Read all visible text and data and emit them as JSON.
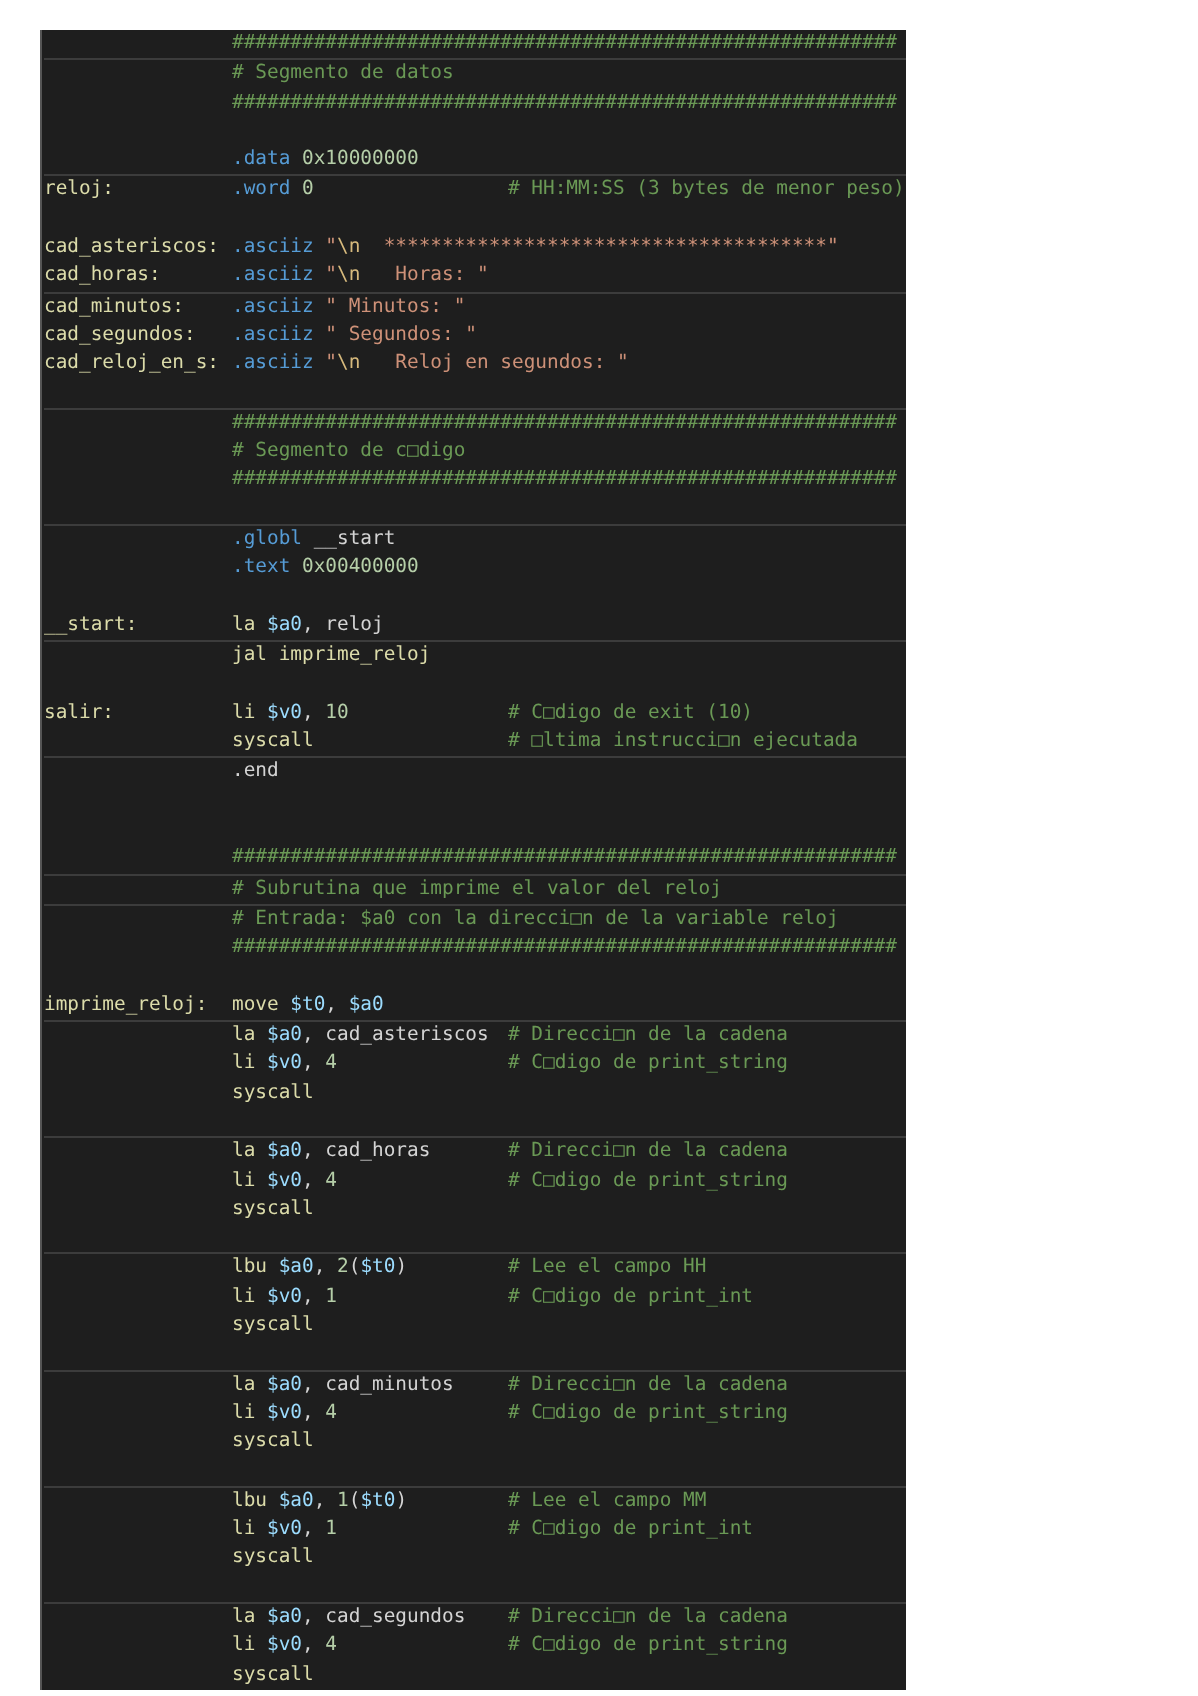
{
  "code_rows": [
    {
      "lines": [
        {
          "kind": "code",
          "tokens": [
            {
              "text": "#########################################################",
              "kind": "com"
            }
          ]
        }
      ]
    },
    {
      "lines": [
        {
          "kind": "code",
          "tokens": [
            {
              "text": "# Segmento de datos",
              "kind": "com"
            }
          ]
        },
        {
          "kind": "code",
          "tokens": [
            {
              "text": "#########################################################",
              "kind": "com"
            }
          ]
        },
        {
          "kind": "blank"
        },
        {
          "kind": "code",
          "tokens": [
            {
              "text": ".data",
              "kind": "dir"
            },
            {
              "text": " 0x10000000",
              "kind": "num"
            }
          ]
        }
      ]
    },
    {
      "lines": [
        {
          "kind": "code",
          "label": "reloj:",
          "tokens": [
            {
              "text": ".word",
              "kind": "dir"
            },
            {
              "text": " 0",
              "kind": "num"
            }
          ],
          "comment": "# HH:MM:SS (3 bytes de menor peso)"
        },
        {
          "kind": "blank"
        },
        {
          "kind": "code",
          "label": "cad_asteriscos:",
          "tokens": [
            {
              "text": ".asciiz",
              "kind": "dir"
            },
            {
              "text": " \"",
              "kind": "str"
            },
            {
              "text": "\\n",
              "kind": "esc"
            },
            {
              "text": "  **************************************\"",
              "kind": "str"
            }
          ]
        },
        {
          "kind": "code",
          "label": "cad_horas:",
          "tokens": [
            {
              "text": ".asciiz",
              "kind": "dir"
            },
            {
              "text": " \"",
              "kind": "str"
            },
            {
              "text": "\\n",
              "kind": "esc"
            },
            {
              "text": "   Horas: \"",
              "kind": "str"
            }
          ]
        }
      ]
    },
    {
      "lines": [
        {
          "kind": "code",
          "label": "cad_minutos:",
          "tokens": [
            {
              "text": ".asciiz",
              "kind": "dir"
            },
            {
              "text": " \" Minutos: \"",
              "kind": "str"
            }
          ]
        },
        {
          "kind": "code",
          "label": "cad_segundos:",
          "tokens": [
            {
              "text": ".asciiz",
              "kind": "dir"
            },
            {
              "text": " \" Segundos: \"",
              "kind": "str"
            }
          ]
        },
        {
          "kind": "code",
          "label": "cad_reloj_en_s:",
          "tokens": [
            {
              "text": ".asciiz",
              "kind": "dir"
            },
            {
              "text": " \"",
              "kind": "str"
            },
            {
              "text": "\\n",
              "kind": "esc"
            },
            {
              "text": "   Reloj en segundos: \"",
              "kind": "str"
            }
          ]
        },
        {
          "kind": "blank"
        }
      ]
    },
    {
      "lines": [
        {
          "kind": "code",
          "tokens": [
            {
              "text": "#########################################################",
              "kind": "com"
            }
          ]
        },
        {
          "kind": "code",
          "tokens": [
            {
              "text": "# Segmento de c□digo",
              "kind": "com"
            }
          ]
        },
        {
          "kind": "code",
          "tokens": [
            {
              "text": "#########################################################",
              "kind": "com"
            }
          ]
        },
        {
          "kind": "blank"
        }
      ]
    },
    {
      "lines": [
        {
          "kind": "code",
          "tokens": [
            {
              "text": ".globl",
              "kind": "dir"
            },
            {
              "text": " __start",
              "kind": "txt"
            }
          ]
        },
        {
          "kind": "code",
          "tokens": [
            {
              "text": ".text",
              "kind": "dir"
            },
            {
              "text": " 0x00400000",
              "kind": "num"
            }
          ]
        },
        {
          "kind": "blank"
        },
        {
          "kind": "code",
          "label": "__start:",
          "tokens": [
            {
              "text": "la ",
              "kind": "op"
            },
            {
              "text": "$a0",
              "kind": "reg"
            },
            {
              "text": ", reloj",
              "kind": "txt"
            }
          ]
        }
      ]
    },
    {
      "lines": [
        {
          "kind": "code",
          "tokens": [
            {
              "text": "jal imprime_reloj",
              "kind": "op"
            }
          ]
        },
        {
          "kind": "blank"
        },
        {
          "kind": "code",
          "label": "salir:",
          "tokens": [
            {
              "text": "li ",
              "kind": "op"
            },
            {
              "text": "$v0",
              "kind": "reg"
            },
            {
              "text": ", ",
              "kind": "txt"
            },
            {
              "text": "10",
              "kind": "num"
            }
          ],
          "comment": "# C□digo de exit (10)"
        },
        {
          "kind": "code",
          "tokens": [
            {
              "text": "syscall",
              "kind": "op"
            }
          ],
          "comment": "# □ltima instrucci□n ejecutada"
        }
      ]
    },
    {
      "lines": [
        {
          "kind": "code",
          "tokens": [
            {
              "text": ".end",
              "kind": "txt"
            }
          ]
        },
        {
          "kind": "blank"
        },
        {
          "kind": "blank"
        },
        {
          "kind": "code",
          "tokens": [
            {
              "text": "#########################################################",
              "kind": "com"
            }
          ]
        }
      ]
    },
    {
      "lines": [
        {
          "kind": "code",
          "tokens": [
            {
              "text": "# Subrutina que imprime el valor del reloj",
              "kind": "com"
            }
          ]
        }
      ]
    },
    {
      "lines": [
        {
          "kind": "code",
          "tokens": [
            {
              "text": "# Entrada: $a0 con la direcci□n de la variable reloj",
              "kind": "com"
            }
          ]
        },
        {
          "kind": "code",
          "tokens": [
            {
              "text": "#########################################################",
              "kind": "com"
            }
          ]
        },
        {
          "kind": "blank"
        },
        {
          "kind": "code",
          "label": "imprime_reloj:",
          "tokens": [
            {
              "text": "move ",
              "kind": "op"
            },
            {
              "text": "$t0",
              "kind": "reg"
            },
            {
              "text": ", ",
              "kind": "txt"
            },
            {
              "text": "$a0",
              "kind": "reg"
            }
          ]
        }
      ]
    },
    {
      "lines": [
        {
          "kind": "code",
          "tokens": [
            {
              "text": "la ",
              "kind": "op"
            },
            {
              "text": "$a0",
              "kind": "reg"
            },
            {
              "text": ", cad_asteriscos",
              "kind": "txt"
            }
          ],
          "comment": "# Direcci□n de la cadena"
        },
        {
          "kind": "code",
          "tokens": [
            {
              "text": "li ",
              "kind": "op"
            },
            {
              "text": "$v0",
              "kind": "reg"
            },
            {
              "text": ", ",
              "kind": "txt"
            },
            {
              "text": "4",
              "kind": "num"
            }
          ],
          "comment": "# C□digo de print_string"
        },
        {
          "kind": "code",
          "tokens": [
            {
              "text": "syscall",
              "kind": "op"
            }
          ]
        },
        {
          "kind": "blank"
        }
      ]
    },
    {
      "lines": [
        {
          "kind": "code",
          "tokens": [
            {
              "text": "la ",
              "kind": "op"
            },
            {
              "text": "$a0",
              "kind": "reg"
            },
            {
              "text": ", cad_horas",
              "kind": "txt"
            }
          ],
          "comment": "# Direcci□n de la cadena"
        },
        {
          "kind": "code",
          "tokens": [
            {
              "text": "li ",
              "kind": "op"
            },
            {
              "text": "$v0",
              "kind": "reg"
            },
            {
              "text": ", ",
              "kind": "txt"
            },
            {
              "text": "4",
              "kind": "num"
            }
          ],
          "comment": "# C□digo de print_string"
        },
        {
          "kind": "code",
          "tokens": [
            {
              "text": "syscall",
              "kind": "op"
            }
          ]
        },
        {
          "kind": "blank"
        }
      ]
    },
    {
      "lines": [
        {
          "kind": "code",
          "tokens": [
            {
              "text": "lbu ",
              "kind": "op"
            },
            {
              "text": "$a0",
              "kind": "reg"
            },
            {
              "text": ", ",
              "kind": "txt"
            },
            {
              "text": "2",
              "kind": "num"
            },
            {
              "text": "(",
              "kind": "txt"
            },
            {
              "text": "$t0",
              "kind": "reg"
            },
            {
              "text": ")",
              "kind": "txt"
            }
          ],
          "comment": "# Lee el campo HH"
        },
        {
          "kind": "code",
          "tokens": [
            {
              "text": "li ",
              "kind": "op"
            },
            {
              "text": "$v0",
              "kind": "reg"
            },
            {
              "text": ", ",
              "kind": "txt"
            },
            {
              "text": "1",
              "kind": "num"
            }
          ],
          "comment": "# C□digo de print_int"
        },
        {
          "kind": "code",
          "tokens": [
            {
              "text": "syscall",
              "kind": "op"
            }
          ]
        },
        {
          "kind": "blank"
        }
      ]
    },
    {
      "lines": [
        {
          "kind": "code",
          "tokens": [
            {
              "text": "la ",
              "kind": "op"
            },
            {
              "text": "$a0",
              "kind": "reg"
            },
            {
              "text": ", cad_minutos",
              "kind": "txt"
            }
          ],
          "comment": "# Direcci□n de la cadena"
        },
        {
          "kind": "code",
          "tokens": [
            {
              "text": "li ",
              "kind": "op"
            },
            {
              "text": "$v0",
              "kind": "reg"
            },
            {
              "text": ", ",
              "kind": "txt"
            },
            {
              "text": "4",
              "kind": "num"
            }
          ],
          "comment": "# C□digo de print_string"
        },
        {
          "kind": "code",
          "tokens": [
            {
              "text": "syscall",
              "kind": "op"
            }
          ]
        },
        {
          "kind": "blank"
        }
      ]
    },
    {
      "lines": [
        {
          "kind": "code",
          "tokens": [
            {
              "text": "lbu ",
              "kind": "op"
            },
            {
              "text": "$a0",
              "kind": "reg"
            },
            {
              "text": ", ",
              "kind": "txt"
            },
            {
              "text": "1",
              "kind": "num"
            },
            {
              "text": "(",
              "kind": "txt"
            },
            {
              "text": "$t0",
              "kind": "reg"
            },
            {
              "text": ")",
              "kind": "txt"
            }
          ],
          "comment": "# Lee el campo MM"
        },
        {
          "kind": "code",
          "tokens": [
            {
              "text": "li ",
              "kind": "op"
            },
            {
              "text": "$v0",
              "kind": "reg"
            },
            {
              "text": ", ",
              "kind": "txt"
            },
            {
              "text": "1",
              "kind": "num"
            }
          ],
          "comment": "# C□digo de print_int"
        },
        {
          "kind": "code",
          "tokens": [
            {
              "text": "syscall",
              "kind": "op"
            }
          ]
        },
        {
          "kind": "blank"
        }
      ]
    },
    {
      "lines": [
        {
          "kind": "code",
          "tokens": [
            {
              "text": "la ",
              "kind": "op"
            },
            {
              "text": "$a0",
              "kind": "reg"
            },
            {
              "text": ", cad_segundos",
              "kind": "txt"
            }
          ],
          "comment": "# Direcci□n de la cadena"
        },
        {
          "kind": "code",
          "tokens": [
            {
              "text": "li ",
              "kind": "op"
            },
            {
              "text": "$v0",
              "kind": "reg"
            },
            {
              "text": ", ",
              "kind": "txt"
            },
            {
              "text": "4",
              "kind": "num"
            }
          ],
          "comment": "# C□digo de print_string"
        },
        {
          "kind": "code",
          "tokens": [
            {
              "text": "syscall",
              "kind": "op"
            }
          ]
        }
      ]
    }
  ]
}
